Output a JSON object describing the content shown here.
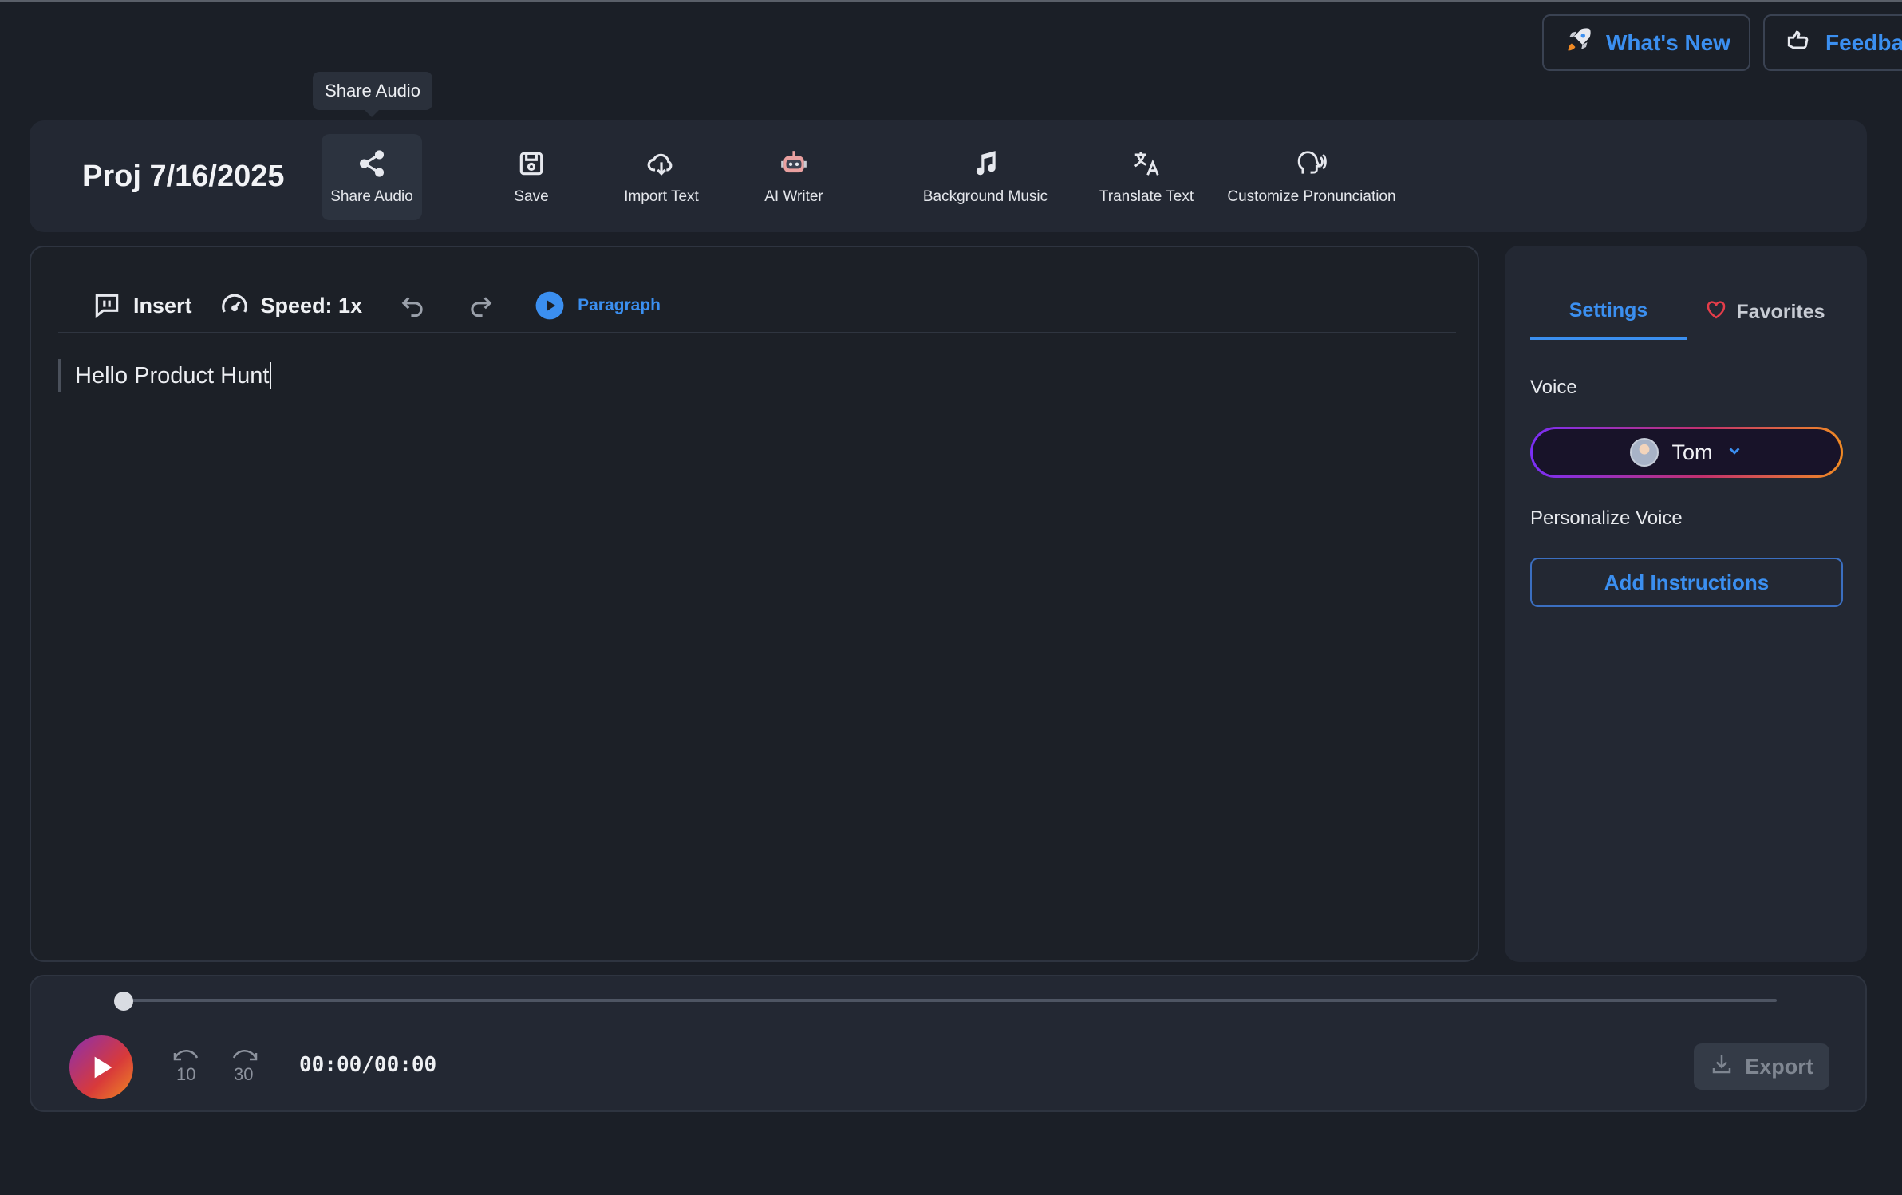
{
  "header": {
    "whats_new_label": "What's New",
    "feedback_label": "Feedba"
  },
  "tooltip": {
    "text": "Share Audio"
  },
  "toolbar": {
    "project_title": "Proj 7/16/2025",
    "tools": [
      {
        "label": "Share Audio",
        "icon": "share-icon"
      },
      {
        "label": "Save",
        "icon": "save-icon"
      },
      {
        "label": "Import Text",
        "icon": "cloud-download-icon"
      },
      {
        "label": "AI Writer",
        "icon": "robot-icon"
      },
      {
        "label": "Background Music",
        "icon": "music-note-icon"
      },
      {
        "label": "Translate Text",
        "icon": "translate-icon"
      },
      {
        "label": "Customize Pronunciation",
        "icon": "speaking-head-icon"
      }
    ]
  },
  "editor": {
    "insert_label": "Insert",
    "speed_label": "Speed: 1x",
    "paragraph_label": "Paragraph",
    "content": "Hello Product Hunt"
  },
  "panel": {
    "tabs": [
      "Settings",
      "Favorites"
    ],
    "voice_label": "Voice",
    "voice_value": "Tom",
    "personalize_label": "Personalize Voice",
    "add_instructions_label": "Add Instructions"
  },
  "player": {
    "skip_back": "10",
    "skip_forward": "30",
    "time": "00:00/00:00",
    "progress": 0,
    "export_label": "Export"
  },
  "colors": {
    "accent": "#3b8ff0",
    "background": "#1b1f27",
    "panel": "#232833"
  }
}
